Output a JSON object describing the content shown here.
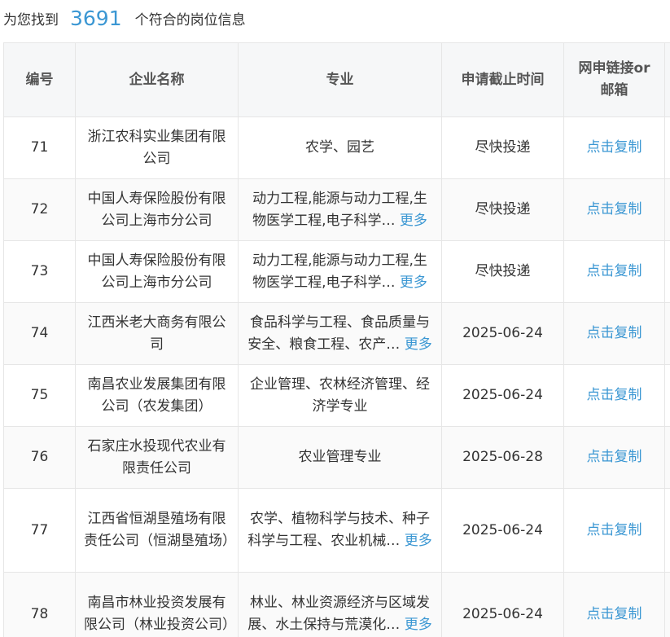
{
  "summary": {
    "prefix": "为您找到",
    "count": "3691",
    "suffix": "个符合的岗位信息"
  },
  "table": {
    "headers": {
      "no": "编号",
      "company": "企业名称",
      "major": "专业",
      "deadline": "申请截止时间",
      "link_line1": "网申链接or",
      "link_line2": "邮箱"
    },
    "rows": [
      {
        "no": "71",
        "company": "浙江农科实业集团有限公司",
        "major": "农学、园艺",
        "more": "",
        "deadline": "尽快投递",
        "link": "点击复制"
      },
      {
        "no": "72",
        "company": "中国人寿保险股份有限公司上海市分公司",
        "major": "动力工程,能源与动力工程,生物医学工程,电子科学…",
        "more": "更多",
        "deadline": "尽快投递",
        "link": "点击复制"
      },
      {
        "no": "73",
        "company": "中国人寿保险股份有限公司上海市分公司",
        "major": "动力工程,能源与动力工程,生物医学工程,电子科学…",
        "more": "更多",
        "deadline": "尽快投递",
        "link": "点击复制"
      },
      {
        "no": "74",
        "company": "江西米老大商务有限公司",
        "major": "食品科学与工程、食品质量与安全、粮食工程、农产…",
        "more": "更多",
        "deadline": "2025-06-24",
        "link": "点击复制"
      },
      {
        "no": "75",
        "company": "南昌农业发展集团有限公司（农发集团）",
        "major": "企业管理、农林经济管理、经济学专业",
        "more": "",
        "deadline": "2025-06-24",
        "link": "点击复制"
      },
      {
        "no": "76",
        "company": "石家庄水投现代农业有限责任公司",
        "major": "农业管理专业",
        "more": "",
        "deadline": "2025-06-28",
        "link": "点击复制"
      },
      {
        "no": "77",
        "company": "江西省恒湖垦殖场有限责任公司（恒湖垦殖场）",
        "major": "农学、植物科学与技术、种子科学与工程、农业机械…",
        "more": "更多",
        "deadline": "2025-06-24",
        "link": "点击复制"
      },
      {
        "no": "78",
        "company": "南昌市林业投资发展有限公司（林业投资公司）",
        "major": "林业、林业资源经济与区域发展、水土保持与荒漠化…",
        "more": "更多",
        "deadline": "2025-06-24",
        "link": "点击复制"
      }
    ]
  }
}
